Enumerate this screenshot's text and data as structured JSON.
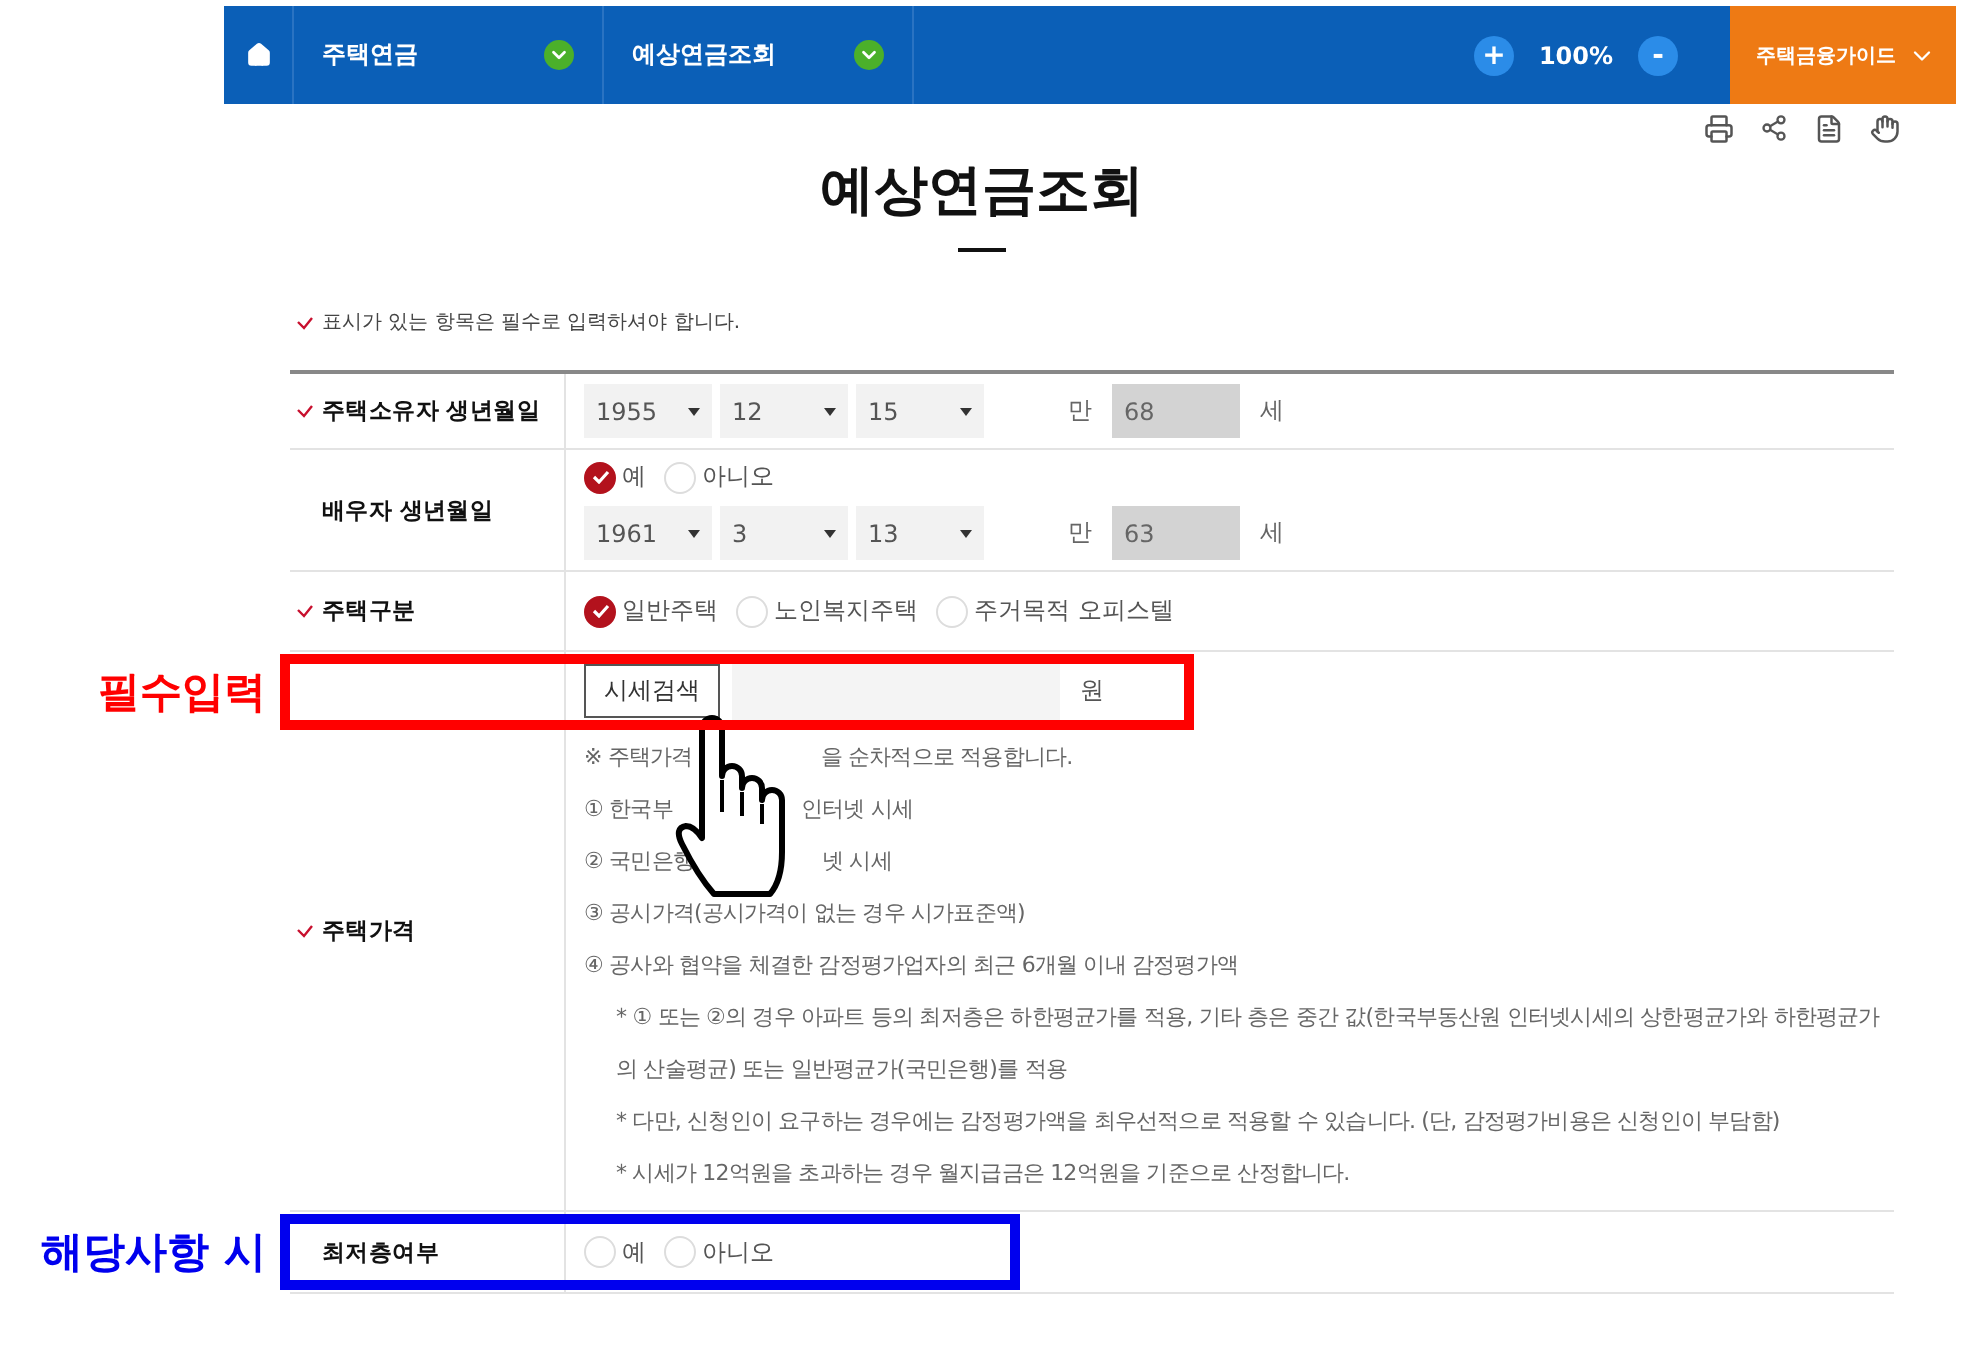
{
  "nav": {
    "items": [
      {
        "label": "주택연금"
      },
      {
        "label": "예상연금조회"
      }
    ],
    "zoom": {
      "plus": "+",
      "level": "100%",
      "minus": "-"
    },
    "guide": "주택금융가이드"
  },
  "title": "예상연금조회",
  "required_note": "표시가 있는 항목은 필수로 입력하셔야 합니다.",
  "rows": [
    {
      "kind": "birth",
      "label": "주택소유자 생년월일",
      "required": true,
      "year": "1955",
      "month": "12",
      "day": "15",
      "age_prefix": "만",
      "age": "68",
      "age_suffix": "세"
    },
    {
      "kind": "spouse",
      "label": "배우자 생년월일",
      "required": false,
      "options": [
        {
          "label": "예",
          "selected": true
        },
        {
          "label": "아니오",
          "selected": false
        }
      ],
      "year": "1961",
      "month": "3",
      "day": "13",
      "age_prefix": "만",
      "age": "63",
      "age_suffix": "세"
    },
    {
      "kind": "radio",
      "label": "주택구분",
      "required": true,
      "options": [
        {
          "label": "일반주택",
          "selected": true
        },
        {
          "label": "노인복지주택",
          "selected": false
        },
        {
          "label": "주거목적 오피스텔",
          "selected": false
        }
      ]
    },
    {
      "kind": "price",
      "label": "주택가격",
      "required": true,
      "button": "시세검색",
      "unit": "원",
      "annotation": {
        "label": "필수입력",
        "color": "#ff0000"
      },
      "notes": [
        {
          "kind": "split",
          "parts": [
            "※ 주택가격",
            "을 순차적으로 적용합니다."
          ]
        },
        {
          "kind": "split",
          "parts": [
            "① 한국부",
            "인터넷 시세"
          ]
        },
        {
          "kind": "split",
          "parts": [
            "② 국민은행",
            "넷 시세"
          ]
        },
        {
          "kind": "main",
          "text": "③ 공시가격(공시가격이 없는 경우 시가표준액)"
        },
        {
          "kind": "main",
          "text": "④ 공사와 협약을 체결한 감정평가업자의 최근 6개월 이내 감정평가액"
        },
        {
          "kind": "sub",
          "text": "* ① 또는 ②의 경우 아파트 등의 최저층은 하한평균가를 적용, 기타 층은 중간 값(한국부동산원 인터넷시세의 상한평균가와 하한평균가의 산술평균) 또는 일반평균가(국민은행)를 적용"
        },
        {
          "kind": "sub",
          "text": "* 다만, 신청인이 요구하는 경우에는 감정평가액을 최우선적으로 적용할 수 있습니다. (단, 감정평가비용은 신청인이 부담함)"
        },
        {
          "kind": "sub",
          "text": "* 시세가 12억원을 초과하는 경우 월지급금은 12억원을 기준으로 산정합니다."
        }
      ]
    },
    {
      "kind": "radio",
      "label": "최저층여부",
      "required": false,
      "annotation": {
        "label": "해당사항 시",
        "color": "#0000ee"
      },
      "options": [
        {
          "label": "예",
          "selected": false
        },
        {
          "label": "아니오",
          "selected": false
        }
      ]
    }
  ]
}
